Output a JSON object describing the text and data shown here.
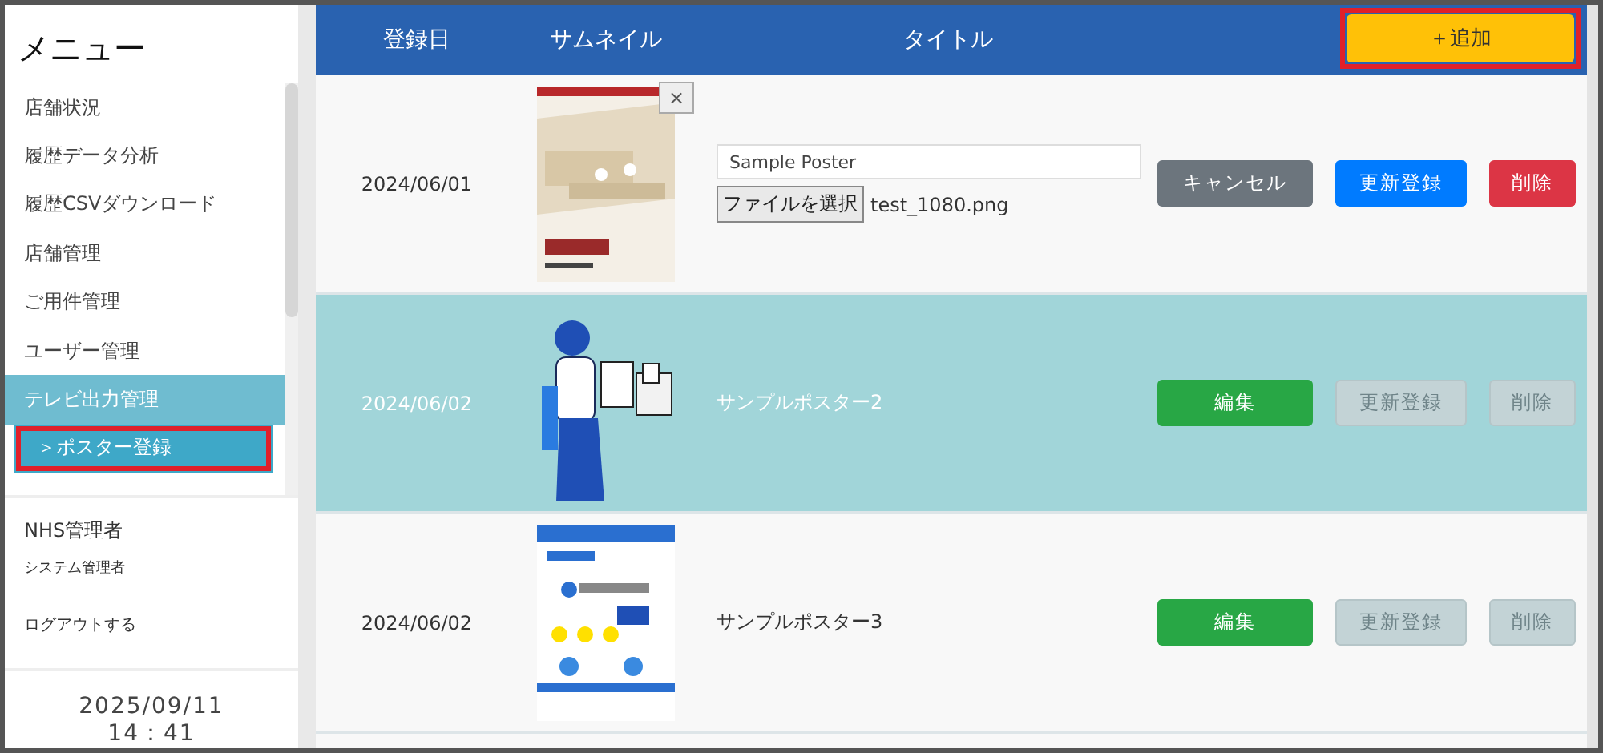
{
  "sidebar": {
    "title": "メニュー",
    "items": [
      {
        "label": "店舗状況",
        "kind": "item",
        "selected": false,
        "highlighted": false
      },
      {
        "label": "履歴データ分析",
        "kind": "item",
        "selected": false,
        "highlighted": false
      },
      {
        "label": "履歴CSVダウンロード",
        "kind": "item",
        "selected": false,
        "highlighted": false
      },
      {
        "label": "店舗管理",
        "kind": "item",
        "selected": false,
        "highlighted": false
      },
      {
        "label": "ご用件管理",
        "kind": "item",
        "selected": false,
        "highlighted": false
      },
      {
        "label": "ユーザー管理",
        "kind": "item",
        "selected": false,
        "highlighted": false
      },
      {
        "label": "テレビ出力管理",
        "kind": "group",
        "selected": false,
        "highlighted": false
      },
      {
        "label": "＞ポスター登録",
        "kind": "sub",
        "selected": true,
        "highlighted": true
      }
    ],
    "user": {
      "company": "NHS管理者",
      "role": "システム管理者"
    },
    "logout": "ログアウトする",
    "date": "2025/09/11",
    "time": "14：41"
  },
  "table": {
    "columns": [
      "登録日",
      "サムネイル",
      "タイトル"
    ],
    "add_button": {
      "label": "＋追加",
      "highlighted": true
    },
    "rows": [
      {
        "date": "2024/06/01",
        "kind": "editing",
        "selected": false,
        "remove": "×",
        "title": "Sample Poster",
        "file_button": "ファイルを選択",
        "file_name": "test_1080.png",
        "buttons": [
          {
            "label": "キャンセル",
            "kind": "cancel",
            "disabled": false
          },
          {
            "label": "更新登録",
            "kind": "update",
            "disabled": false
          },
          {
            "label": "削除",
            "kind": "delete",
            "disabled": false
          }
        ]
      },
      {
        "date": "2024/06/02",
        "kind": "view",
        "selected": true,
        "title": "サンプルポスター2",
        "buttons": [
          {
            "label": "編集",
            "kind": "edit",
            "disabled": false
          },
          {
            "label": "更新登録",
            "kind": "update",
            "disabled": true
          },
          {
            "label": "削除",
            "kind": "delete",
            "disabled": true
          }
        ]
      },
      {
        "date": "2024/06/02",
        "kind": "view",
        "selected": false,
        "title": "サンプルポスター3",
        "buttons": [
          {
            "label": "編集",
            "kind": "edit",
            "disabled": false
          },
          {
            "label": "更新登録",
            "kind": "update",
            "disabled": true
          },
          {
            "label": "削除",
            "kind": "delete",
            "disabled": true
          }
        ]
      }
    ]
  }
}
